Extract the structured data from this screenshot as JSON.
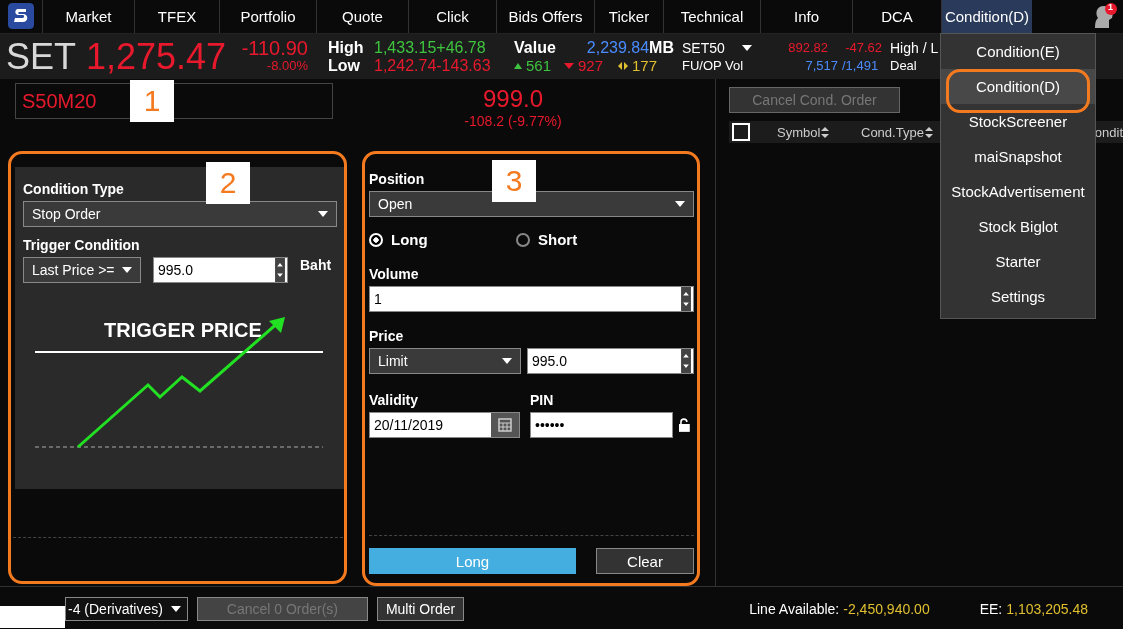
{
  "nav": {
    "tabs": [
      {
        "label": "Market",
        "selected": false
      },
      {
        "label": "TFEX",
        "selected": false
      },
      {
        "label": "Portfolio",
        "selected": false
      },
      {
        "label": "Quote",
        "selected": false
      },
      {
        "label": "Click",
        "selected": false
      },
      {
        "label": "Bids Offers",
        "selected": false
      },
      {
        "label": "Ticker",
        "selected": false
      },
      {
        "label": "Technical",
        "selected": false
      },
      {
        "label": "Info",
        "selected": false
      },
      {
        "label": "DCA",
        "selected": false
      },
      {
        "label": "Condition(D)",
        "selected": true
      }
    ],
    "notification_count": "1"
  },
  "ticker": {
    "index": "SET",
    "last": "1,275.47",
    "change": "-110.90",
    "percent": "-8.00%",
    "high_label": "High",
    "high": "1,433.15",
    "high_change": "+46.78",
    "low_label": "Low",
    "low": "1,242.74",
    "low_change": "-143.63",
    "value_label": "Value",
    "value": "2,239.84",
    "value_unit": "MB",
    "up": "561",
    "down": "927",
    "unchanged": "177",
    "set50_name": "SET50",
    "set50_price": "892.82",
    "set50_change": "-47.62",
    "high_low_label": "High / L",
    "fuop_label": "FU/OP Vol",
    "fu_volume": "7,517",
    "op_volume": "/1,491",
    "deal_label": "Deal"
  },
  "symbol": {
    "value": "S50M20",
    "price": "999.0",
    "change": "-108.2 (-9.77%)"
  },
  "condition_panel": {
    "type_label": "Condition Type",
    "type_value": "Stop Order",
    "trigger_label": "Trigger Condition",
    "operator": "Last Price >=",
    "trigger_value": "995.0",
    "unit": "Baht",
    "drawing_label": "TRIGGER PRICE"
  },
  "order_panel": {
    "position_label": "Position",
    "position_value": "Open",
    "sides": [
      {
        "label": "Long",
        "selected": true
      },
      {
        "label": "Short",
        "selected": false
      }
    ],
    "volume_label": "Volume",
    "volume": "1",
    "price_label": "Price",
    "price_type": "Limit",
    "price": "995.0",
    "validity_label": "Validity",
    "validity": "20/11/2019",
    "pin_label": "PIN",
    "pin": "••••••",
    "submit": "Long",
    "clear": "Clear"
  },
  "orders": {
    "select_all": {
      "checked": false
    },
    "cancel_button": {
      "label": "Cancel Cond. Order",
      "disabled": true
    },
    "columns": [
      "Symbol",
      "Cond.Type",
      "ondit"
    ]
  },
  "menu": {
    "items": [
      {
        "label": "Condition(E)",
        "selected": false
      },
      {
        "label": "Condition(D)",
        "selected": true
      },
      {
        "label": "StockScreener",
        "selected": false
      },
      {
        "label": "maiSnapshot",
        "selected": false
      },
      {
        "label": "StockAdvertisement",
        "selected": false
      },
      {
        "label": "Stock Biglot",
        "selected": false
      },
      {
        "label": "Starter",
        "selected": false
      },
      {
        "label": "Settings",
        "selected": false
      }
    ]
  },
  "status_bar": {
    "account": "-4 (Derivatives)",
    "cancel_orders": {
      "label": "Cancel 0 Order(s)",
      "disabled": true
    },
    "multi_order": "Multi Order",
    "line_label": "Line Available:",
    "line_value": "-2,450,940.00",
    "ee_label": "EE:",
    "ee_value": "1,103,205.48"
  },
  "annotations": [
    {
      "label": "1"
    },
    {
      "label": "2"
    },
    {
      "label": "3"
    }
  ]
}
